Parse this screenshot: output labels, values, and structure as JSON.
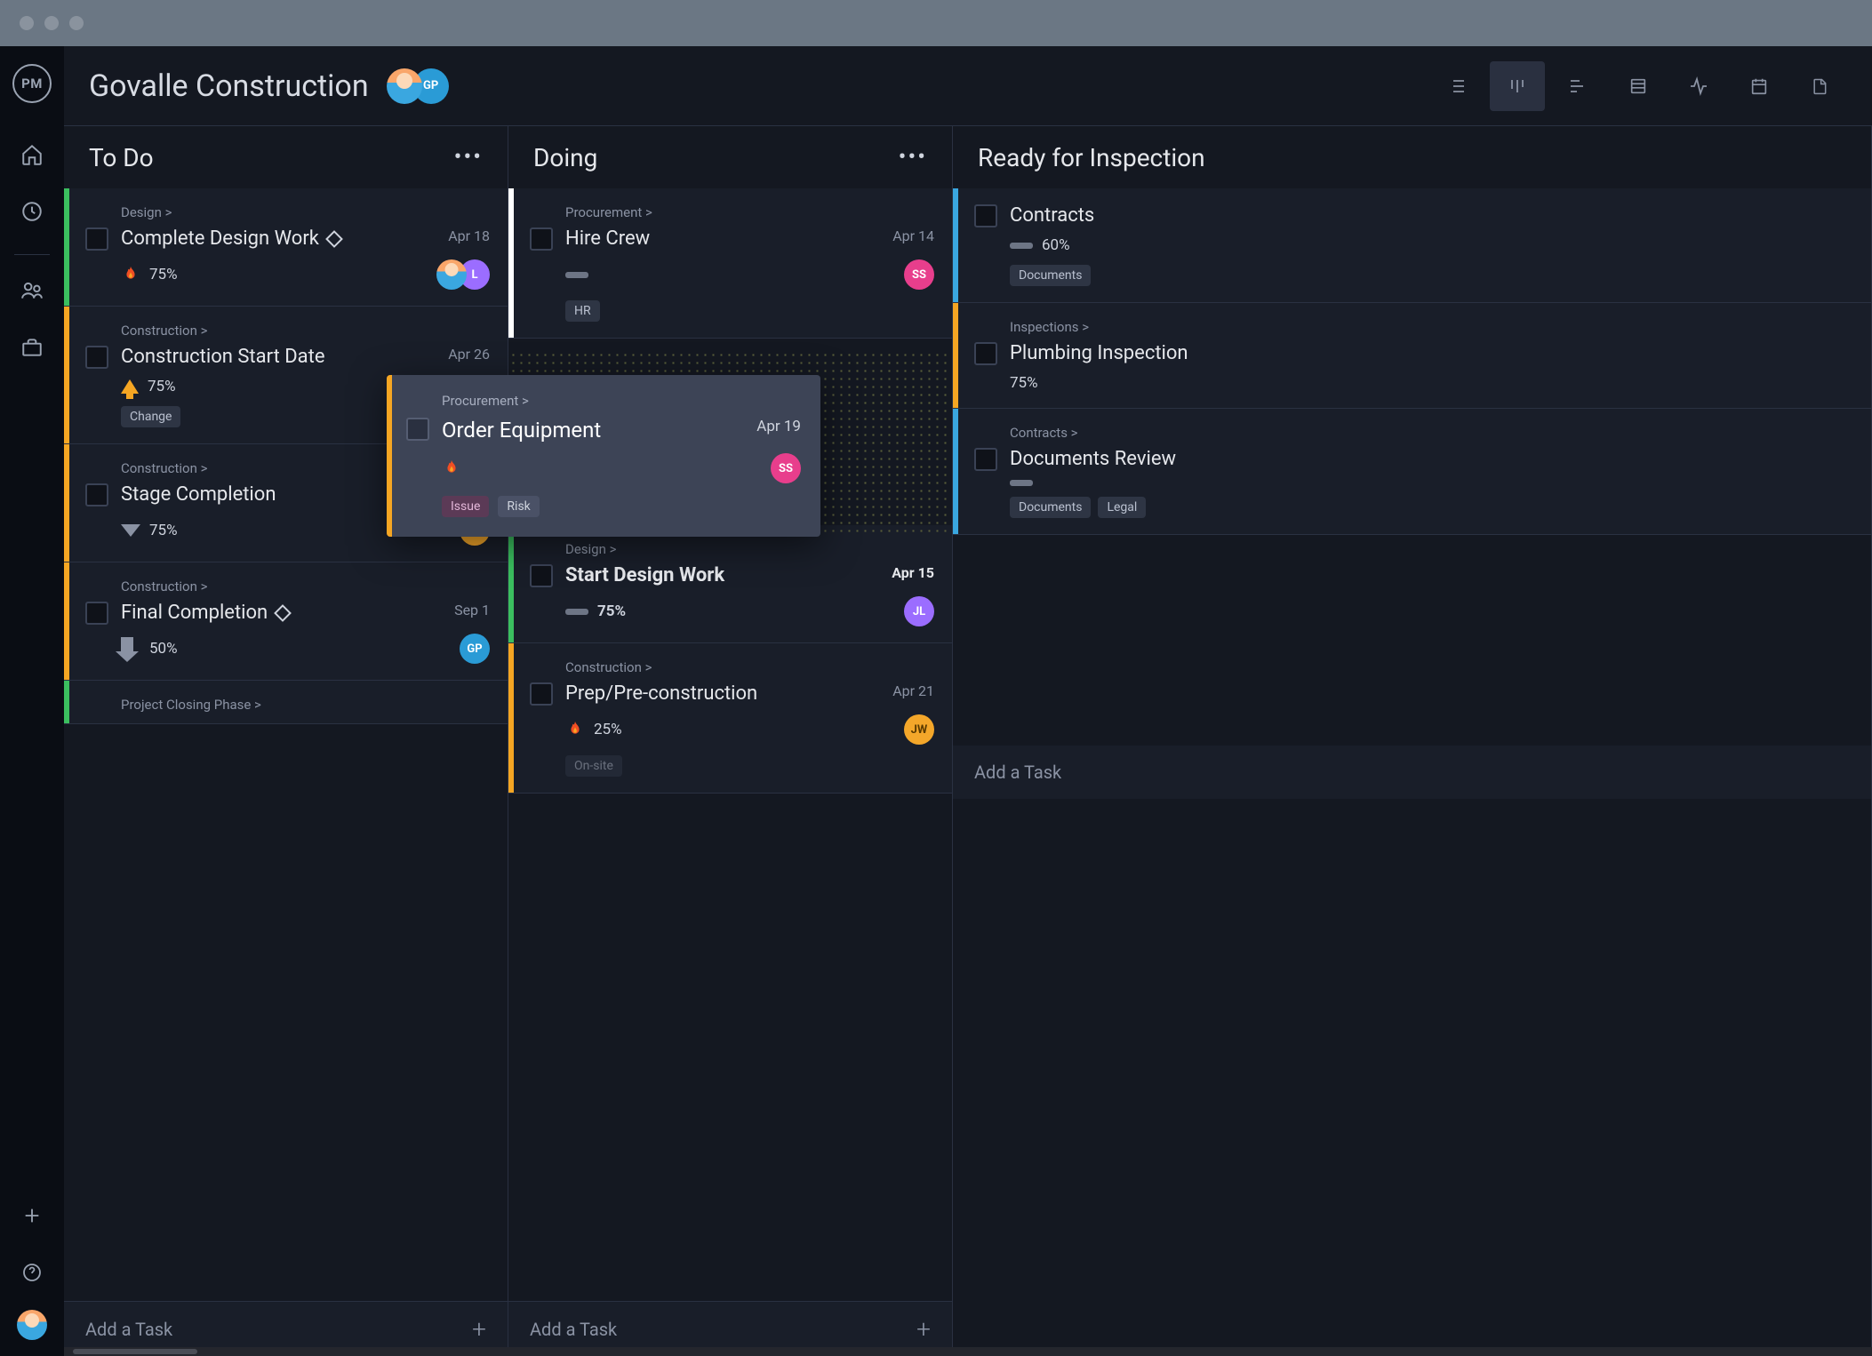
{
  "header": {
    "title": "Govalle Construction",
    "avatar2_initials": "GP"
  },
  "columns": {
    "todo": {
      "title": "To Do",
      "add": "Add a Task"
    },
    "doing": {
      "title": "Doing",
      "add": "Add a Task"
    },
    "ready": {
      "title": "Ready for Inspection",
      "add": "Add a Task"
    }
  },
  "cards": {
    "todo": [
      {
        "crumb": "Design >",
        "title": "Complete Design Work",
        "date": "Apr 18",
        "pct": "75%",
        "stripe": "#3bbf5f",
        "icon": "flame",
        "diamond": true,
        "assignees": [
          {
            "type": "user"
          },
          {
            "type": "violet",
            "label": "L"
          }
        ],
        "tags": []
      },
      {
        "crumb": "Construction >",
        "title": "Construction Start Date",
        "date": "Apr 26",
        "pct": "75%",
        "stripe": "#f5a623",
        "icon": "arrow-up",
        "tags": [
          "Change"
        ]
      },
      {
        "crumb": "Construction >",
        "title": "Stage Completion",
        "date": "",
        "pct": "75%",
        "stripe": "#f5a623",
        "icon": "tri-down",
        "assignees": [
          {
            "type": "amber",
            "label": "JW"
          }
        ],
        "tags": []
      },
      {
        "crumb": "Construction >",
        "title": "Final Completion",
        "date": "Sep 1",
        "pct": "50%",
        "stripe": "#f5a623",
        "icon": "arrow-down",
        "diamond": true,
        "assignees": [
          {
            "type": "teal",
            "label": "GP"
          }
        ],
        "tags": []
      },
      {
        "crumb": "Project Closing Phase >",
        "title": "",
        "date": "",
        "pct": "",
        "stripe": "#3bbf5f",
        "icon": "",
        "tags": []
      }
    ],
    "doing": [
      {
        "crumb": "Procurement >",
        "title": "Hire Crew",
        "date": "Apr 14",
        "pct": "",
        "stripe": "#ffffff",
        "icon": "bar",
        "assignees": [
          {
            "type": "pink",
            "label": "SS"
          }
        ],
        "tags": [
          "HR"
        ]
      },
      {
        "crumb": "Design >",
        "title": "Start Design Work",
        "date": "Apr 15",
        "pct": "75%",
        "stripe": "#3bbf5f",
        "icon": "bar",
        "bold": true,
        "assignees": [
          {
            "type": "violet",
            "label": "JL"
          }
        ],
        "tags": []
      },
      {
        "crumb": "Construction >",
        "title": "Prep/Pre-construction",
        "date": "Apr 21",
        "pct": "25%",
        "stripe": "#f5a623",
        "icon": "flame",
        "assignees": [
          {
            "type": "amber",
            "label": "JW"
          }
        ],
        "tags": [
          "On-site"
        ]
      }
    ],
    "ready": [
      {
        "crumb": "",
        "title": "Contracts",
        "date": "",
        "pct": "60%",
        "stripe": "#3aa7e0",
        "icon": "bar",
        "tags": [
          "Documents"
        ]
      },
      {
        "crumb": "Inspections >",
        "title": "Plumbing Inspection",
        "date": "",
        "pct": "75%",
        "stripe": "#f5a623",
        "icon": "",
        "tags": []
      },
      {
        "crumb": "Contracts >",
        "title": "Documents Review",
        "date": "",
        "pct": "",
        "stripe": "#3aa7e0",
        "icon": "bar",
        "tags": [
          "Documents",
          "Legal"
        ]
      }
    ]
  },
  "drag": {
    "crumb": "Procurement >",
    "title": "Order Equipment",
    "date": "Apr 19",
    "assignee": "SS",
    "tag1": "Issue",
    "tag2": "Risk"
  },
  "colors": {
    "pink": "#e83e8c",
    "violet": "#9b6dff",
    "amber": "#f4a72a",
    "teal": "#2a9bd6"
  }
}
